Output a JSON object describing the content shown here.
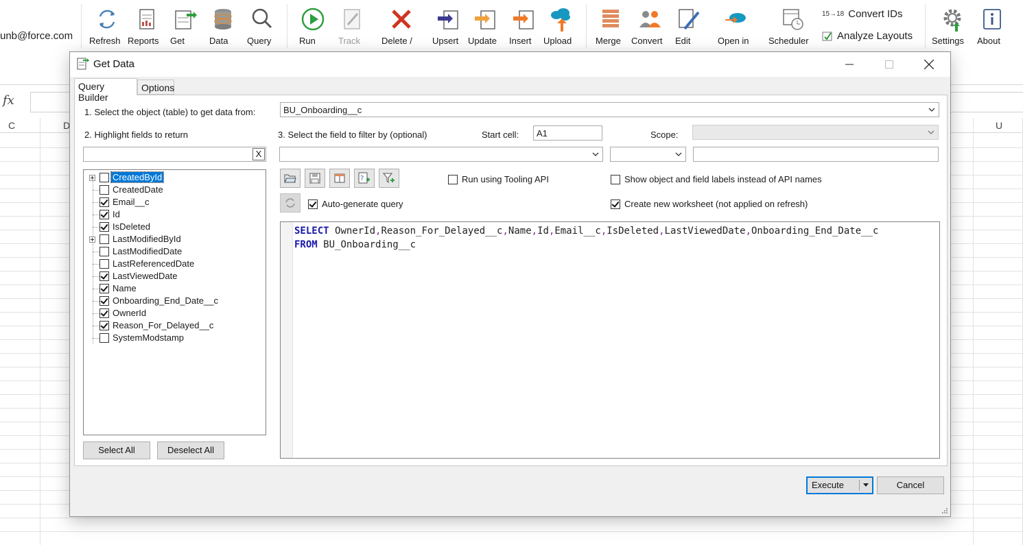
{
  "excel": {
    "user_email": "unb@force.com",
    "fx_label": "fx",
    "columns": [
      "C",
      "D",
      "U"
    ]
  },
  "ribbon": {
    "buttons": [
      {
        "label": "Refresh",
        "icon": "refresh-icon"
      },
      {
        "label": "Reports",
        "icon": "reports-icon"
      },
      {
        "label": "Get",
        "icon": "get-icon"
      },
      {
        "label": "Data",
        "icon": "database-icon"
      },
      {
        "label": "Query",
        "icon": "magnifier-icon"
      },
      {
        "label": "Run",
        "icon": "play-icon"
      },
      {
        "label": "Track",
        "icon": "track-icon"
      },
      {
        "label": "Delete /",
        "icon": "delete-x-icon"
      },
      {
        "label": "Upsert",
        "icon": "upsert-icon"
      },
      {
        "label": "Update",
        "icon": "update-icon"
      },
      {
        "label": "Insert",
        "icon": "insert-icon"
      },
      {
        "label": "Upload",
        "icon": "upload-cloud-icon"
      },
      {
        "label": "Merge",
        "icon": "merge-icon"
      },
      {
        "label": "Convert",
        "icon": "convert-icon"
      },
      {
        "label": "Edit",
        "icon": "edit-icon"
      },
      {
        "label": "Open in",
        "icon": "open-in-icon"
      },
      {
        "label": "Scheduler",
        "icon": "scheduler-icon"
      },
      {
        "label": "Settings",
        "icon": "settings-gear-icon"
      },
      {
        "label": "About",
        "icon": "info-icon"
      }
    ],
    "convert_ids": {
      "badge": "15→18",
      "label": "Convert IDs"
    },
    "analyze_layouts": {
      "label": "Analyze Layouts"
    }
  },
  "dialog": {
    "title": "Get Data",
    "tabs": [
      "Query Builder",
      "Options"
    ],
    "step1_label": "1. Select the object (table) to get data from:",
    "object_value": "BU_Onboarding__c",
    "step2_label": "2. Highlight fields to return",
    "field_search_value": "",
    "clear_label": "X",
    "step3_label": "3. Select the field to filter by (optional)",
    "start_cell_label": "Start cell:",
    "start_cell_value": "A1",
    "scope_label": "Scope:",
    "fields": [
      {
        "name": "CreatedById",
        "checked": false,
        "expandable": true,
        "selected": true
      },
      {
        "name": "CreatedDate",
        "checked": false,
        "expandable": false,
        "selected": false
      },
      {
        "name": "Email__c",
        "checked": true,
        "expandable": false,
        "selected": false
      },
      {
        "name": "Id",
        "checked": true,
        "expandable": false,
        "selected": false
      },
      {
        "name": "IsDeleted",
        "checked": true,
        "expandable": false,
        "selected": false
      },
      {
        "name": "LastModifiedById",
        "checked": false,
        "expandable": true,
        "selected": false
      },
      {
        "name": "LastModifiedDate",
        "checked": false,
        "expandable": false,
        "selected": false
      },
      {
        "name": "LastReferencedDate",
        "checked": false,
        "expandable": false,
        "selected": false
      },
      {
        "name": "LastViewedDate",
        "checked": true,
        "expandable": false,
        "selected": false
      },
      {
        "name": "Name",
        "checked": true,
        "expandable": false,
        "selected": false
      },
      {
        "name": "Onboarding_End_Date__c",
        "checked": true,
        "expandable": false,
        "selected": false
      },
      {
        "name": "OwnerId",
        "checked": true,
        "expandable": false,
        "selected": false
      },
      {
        "name": "Reason_For_Delayed__c",
        "checked": true,
        "expandable": false,
        "selected": false
      },
      {
        "name": "SystemModstamp",
        "checked": false,
        "expandable": false,
        "selected": false
      }
    ],
    "select_all": "Select All",
    "deselect_all": "Deselect All",
    "run_tooling_api": {
      "label": "Run using Tooling API",
      "checked": false
    },
    "show_labels": {
      "label": "Show object and field labels instead of API names",
      "checked": false
    },
    "auto_generate": {
      "label": "Auto-generate query",
      "checked": true
    },
    "create_worksheet": {
      "label": "Create new worksheet (not applied on refresh)",
      "checked": true
    },
    "query": {
      "select_kw": "SELECT",
      "select_fields": [
        "OwnerId",
        "Reason_For_Delayed__c",
        "Name",
        "Id",
        "Email__c",
        "IsDeleted",
        "LastViewedDate",
        "Onboarding_End_Date__c"
      ],
      "from_kw": "FROM",
      "from_object": "BU_Onboarding__c"
    },
    "execute": "Execute",
    "cancel": "Cancel"
  },
  "colors": {
    "accent": "#0078d7",
    "selection": "#0078d7",
    "keyword": "#1a17a8"
  }
}
